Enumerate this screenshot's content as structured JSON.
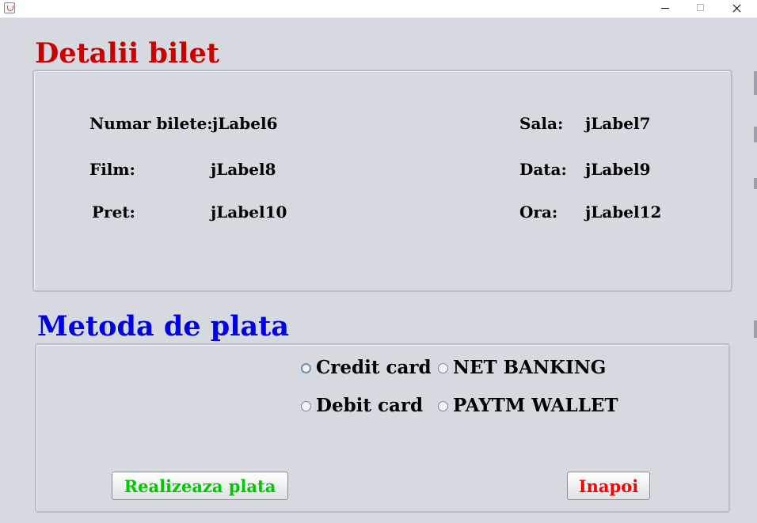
{
  "window": {
    "title": "",
    "icon": "java-cup-icon",
    "controls": [
      "minimize",
      "maximize",
      "close"
    ]
  },
  "details": {
    "title": "Detalii bilet",
    "fields": [
      {
        "label": "Numar bilete:",
        "value": "jLabel6"
      },
      {
        "label": "Film:",
        "value": "jLabel8"
      },
      {
        "label": "Pret:",
        "value": "jLabel10"
      },
      {
        "label": "Sala:",
        "value": "jLabel7"
      },
      {
        "label": "Data:",
        "value": "jLabel9"
      },
      {
        "label": "Ora:",
        "value": "jLabel12"
      }
    ]
  },
  "payment": {
    "title": "Metoda de plata",
    "options": [
      {
        "label": "Credit card",
        "selected": false
      },
      {
        "label": "NET BANKING",
        "selected": false
      },
      {
        "label": "Debit card",
        "selected": false
      },
      {
        "label": "PAYTM WALLET",
        "selected": false
      }
    ],
    "pay_button": "Realizeaza plata",
    "back_button": "Inapoi"
  },
  "colors": {
    "background": "#d6d9e0",
    "details_title": "#c80000",
    "payment_title": "#0000e6",
    "pay_button_text": "#00c800",
    "back_button_text": "#ff0000"
  }
}
